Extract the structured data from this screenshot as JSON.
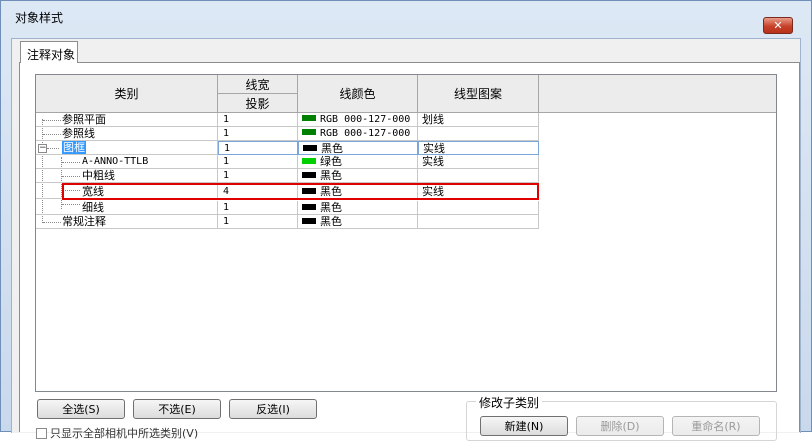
{
  "window": {
    "title": "对象样式",
    "close_glyph": "✕"
  },
  "tabs": [
    {
      "label": "注释对象"
    }
  ],
  "table": {
    "headers": {
      "category": "类别",
      "line_weight": "线宽",
      "projection": "投影",
      "line_color": "线颜色",
      "line_pattern": "线型图案"
    },
    "rows": [
      {
        "name": "参照平面",
        "weight": "1",
        "color": "RGB 000-127-000",
        "swatch": "#008000",
        "pattern": "划线"
      },
      {
        "name": "参照线",
        "weight": "1",
        "color": "RGB 000-127-000",
        "swatch": "#008000",
        "pattern": ""
      },
      {
        "name": "图框",
        "weight": "1",
        "color": "黑色",
        "swatch": "#000000",
        "pattern": "实线",
        "expander": "−",
        "selected": true
      },
      {
        "name": "A-ANNO-TTLB",
        "weight": "1",
        "color": "绿色",
        "swatch": "#00d000",
        "pattern": "实线"
      },
      {
        "name": "中粗线",
        "weight": "1",
        "color": "黑色",
        "swatch": "#000000",
        "pattern": ""
      },
      {
        "name": "宽线",
        "weight": "4",
        "color": "黑色",
        "swatch": "#000000",
        "pattern": "实线",
        "highlighted": true
      },
      {
        "name": "细线",
        "weight": "1",
        "color": "黑色",
        "swatch": "#000000",
        "pattern": ""
      },
      {
        "name": "常规注释",
        "weight": "1",
        "color": "黑色",
        "swatch": "#000000",
        "pattern": ""
      }
    ]
  },
  "buttons": {
    "select_all": "全选(S)",
    "select_none": "不选(E)",
    "invert": "反选(I)"
  },
  "modify_subcategories": {
    "label": "修改子类别",
    "new": "新建(N)",
    "delete": "删除(D)",
    "rename": "重命名(R)"
  },
  "checkbox": {
    "label": "只显示全部相机中所选类别(V)",
    "checked": false
  }
}
